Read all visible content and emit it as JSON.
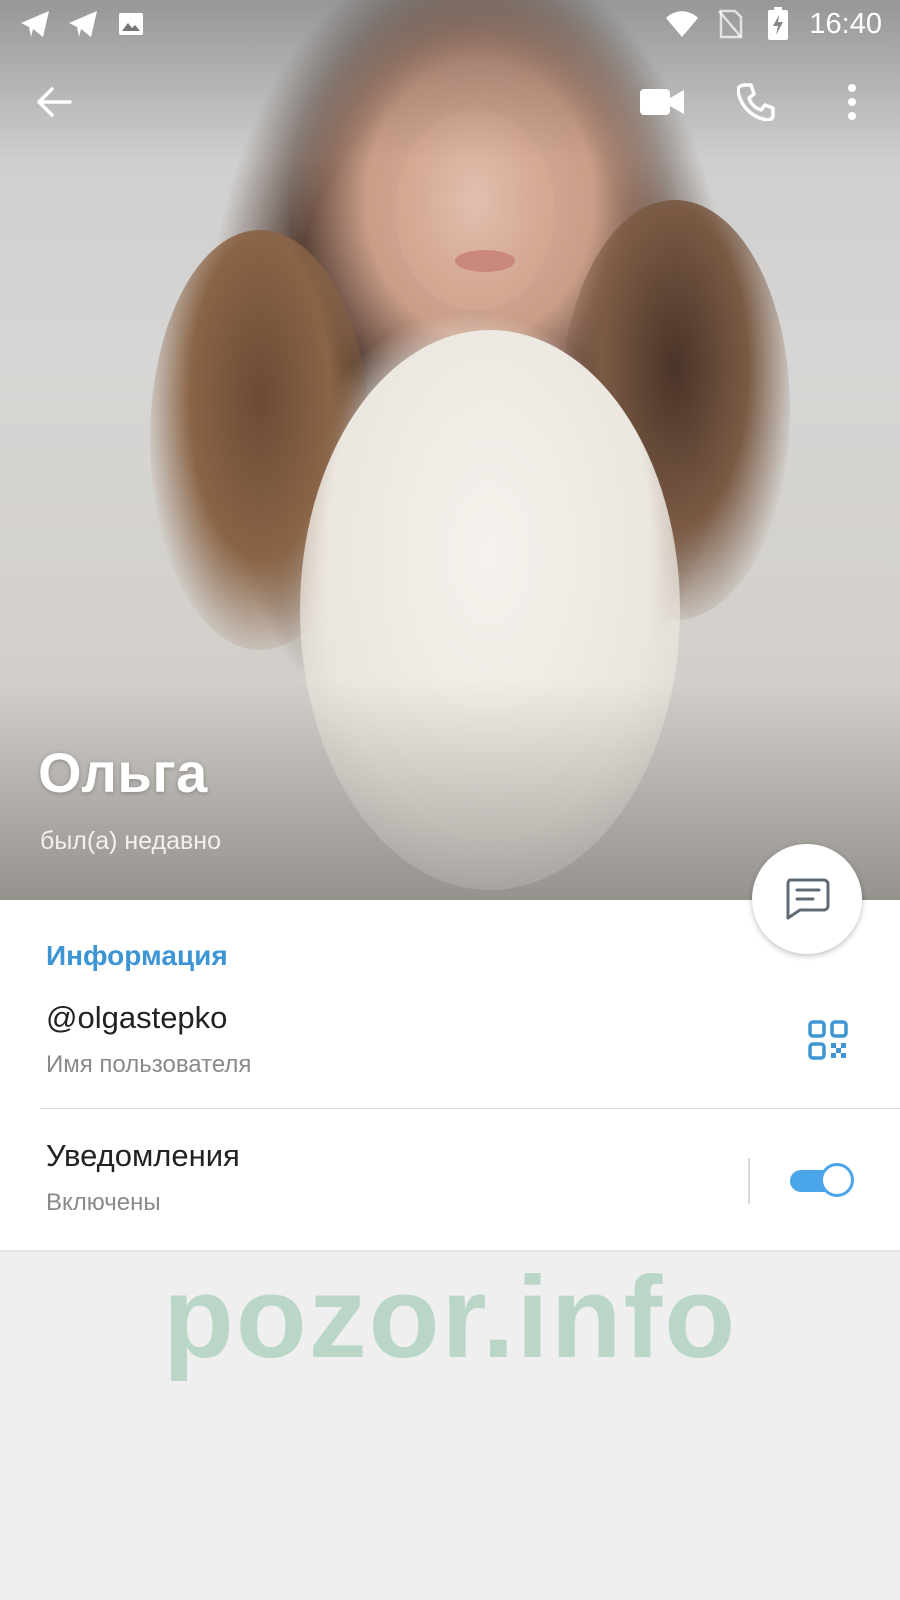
{
  "status_bar": {
    "time": "16:40",
    "left_icons": [
      "telegram-icon",
      "telegram-icon",
      "image-icon"
    ],
    "right_icons": [
      "wifi-icon",
      "no-sim-icon",
      "battery-charging-icon"
    ]
  },
  "action_bar": {
    "icons": [
      "back-arrow-icon",
      "video-call-icon",
      "phone-icon",
      "more-vert-icon"
    ]
  },
  "profile": {
    "name": "Ольга",
    "status": "был(а) недавно"
  },
  "info": {
    "section_title": "Информация",
    "username": "@olgastepko",
    "username_label": "Имя пользователя",
    "notifications_title": "Уведомления",
    "notifications_state": "Включены",
    "notifications_enabled": true
  },
  "colors": {
    "accent": "#3d95d4",
    "toggle": "#4aa6e8",
    "watermark": "#b9d6c6"
  },
  "watermark": "pozor.info"
}
